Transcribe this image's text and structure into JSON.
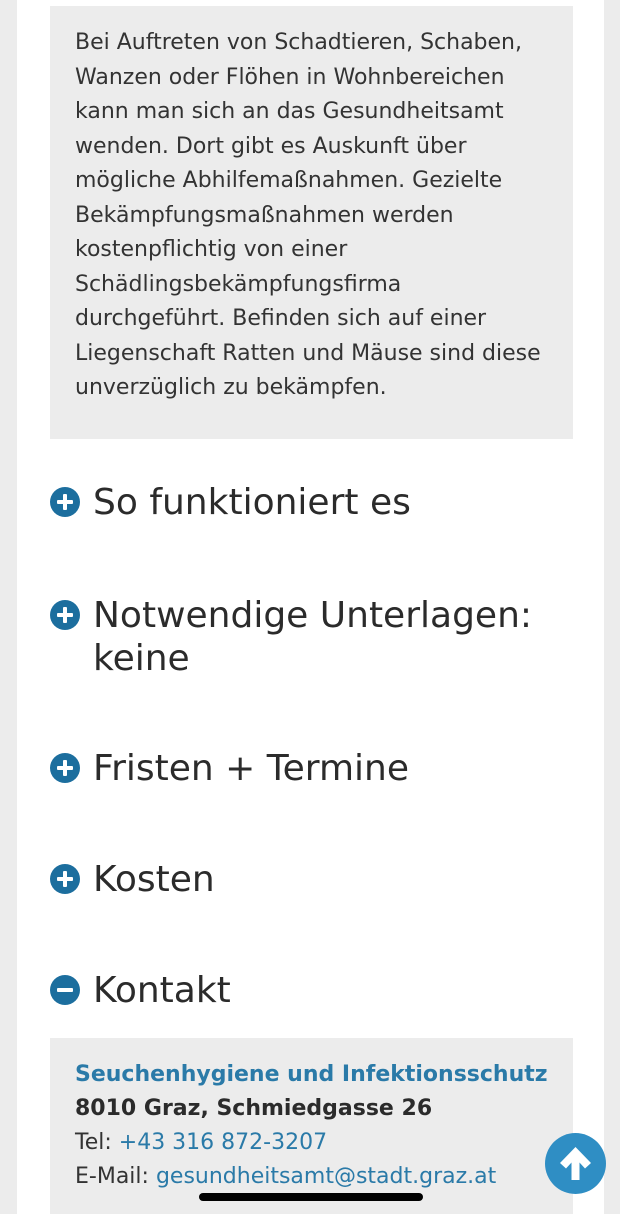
{
  "info": {
    "text": "Bei Auftreten von Schadtieren, Schaben, Wanzen oder Flöhen in Wohnbereichen kann man sich an das Gesundheitsamt wenden. Dort gibt es Auskunft über mögliche Abhilfemaßnahmen. Gezielte Bekämpfungsmaßnahmen werden kostenpflichtig von einer Schädlingsbekämpfungsfirma durchgeführt. Befinden sich auf einer Liegenschaft Ratten und Mäuse sind diese unverzüglich zu bekämpfen."
  },
  "accordion": [
    {
      "label": "So funktioniert es",
      "icon": "plus-circle-icon"
    },
    {
      "label": "Notwendige Unterlagen: keine",
      "icon": "plus-circle-icon"
    },
    {
      "label": "Fristen + Termine",
      "icon": "plus-circle-icon"
    },
    {
      "label": "Kosten",
      "icon": "plus-circle-icon"
    },
    {
      "label": "Kontakt",
      "icon": "minus-circle-icon"
    }
  ],
  "contact": {
    "org": "Seuchenhygiene und Infektionsschutz",
    "address": "8010 Graz, Schmiedgasse 26",
    "tel_label": "Tel: ",
    "tel_value": "+43 316 872-3207",
    "email_label": "E-Mail: ",
    "email_value": "gesundheitsamt@stadt.graz.at"
  },
  "scroll_top_icon": "arrow-up-icon",
  "colors": {
    "accent": "#1c6e9e",
    "link": "#2a7aa8",
    "box_bg": "#ececec",
    "scroll_button": "#2f8ec4"
  }
}
